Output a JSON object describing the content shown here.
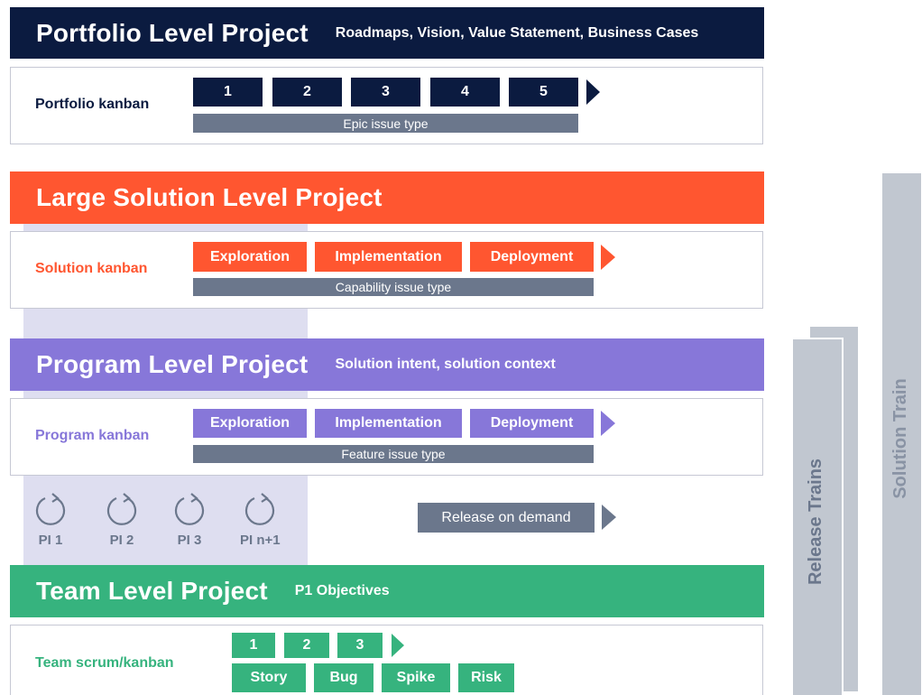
{
  "colors": {
    "portfolio": "#0b1b40",
    "solution": "#ff5630",
    "program": "#8777d9",
    "team": "#36b37e",
    "grey_bar": "#6b778c",
    "lavender": "#dedef0",
    "train_grey": "#c1c7d0"
  },
  "portfolio": {
    "title": "Portfolio Level Project",
    "subtitle": "Roadmaps, Vision, Value Statement, Business Cases",
    "kanban_label": "Portfolio kanban",
    "steps": [
      "1",
      "2",
      "3",
      "4",
      "5"
    ],
    "issue_type": "Epic issue type"
  },
  "solution": {
    "title": "Large Solution Level Project",
    "kanban_label": "Solution kanban",
    "steps": [
      "Exploration",
      "Implementation",
      "Deployment"
    ],
    "issue_type": "Capability issue type"
  },
  "program": {
    "title": "Program Level Project",
    "subtitle": "Solution intent, solution context",
    "kanban_label": "Program kanban",
    "steps": [
      "Exploration",
      "Implementation",
      "Deployment"
    ],
    "issue_type": "Feature issue type",
    "increments": [
      "PI 1",
      "PI 2",
      "PI 3",
      "PI n+1"
    ],
    "release_label": "Release on demand"
  },
  "team": {
    "title": "Team Level Project",
    "subtitle": "P1 Objectives",
    "kanban_label": "Team scrum/kanban",
    "steps": [
      "1",
      "2",
      "3"
    ],
    "issue_types": [
      "Story",
      "Bug",
      "Spike",
      "Risk"
    ]
  },
  "side": {
    "release_trains": "Release Trains",
    "solution_train": "Solution Train"
  }
}
